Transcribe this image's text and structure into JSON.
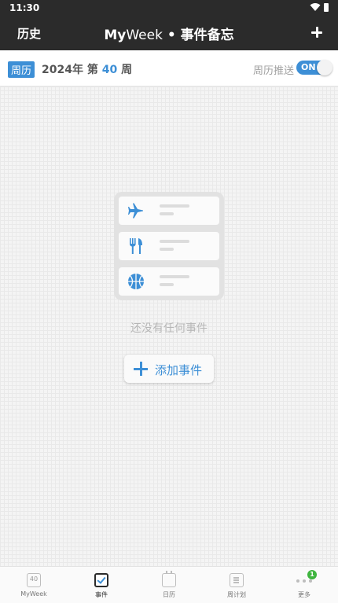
{
  "status_bar": {
    "time": "11:30"
  },
  "app_bar": {
    "history_label": "历史",
    "brand_my": "My",
    "brand_week": "Week",
    "title_suffix": " • 事件备忘"
  },
  "week_bar": {
    "badge": "周历",
    "year_text": "2024年 第 ",
    "week_number": "40",
    "week_suffix": " 周",
    "push_label": "周历推送",
    "toggle_label": "ON"
  },
  "empty_state": {
    "message": "还没有任何事件",
    "add_button": "添加事件",
    "icons": [
      "airplane-icon",
      "utensils-icon",
      "basketball-icon"
    ]
  },
  "bottom_nav": {
    "items": [
      {
        "label": "MyWeek",
        "icon": "calendar-40-icon",
        "icon_text": "40"
      },
      {
        "label": "事件",
        "icon": "checkbox-icon",
        "active": true
      },
      {
        "label": "日历",
        "icon": "calendar-icon"
      },
      {
        "label": "周计划",
        "icon": "list-icon"
      },
      {
        "label": "更多",
        "icon": "more-dots-icon",
        "badge": "1"
      }
    ]
  },
  "colors": {
    "accent": "#3d8fd6",
    "header": "#2b2b2b",
    "badge_green": "#3fb53f"
  }
}
